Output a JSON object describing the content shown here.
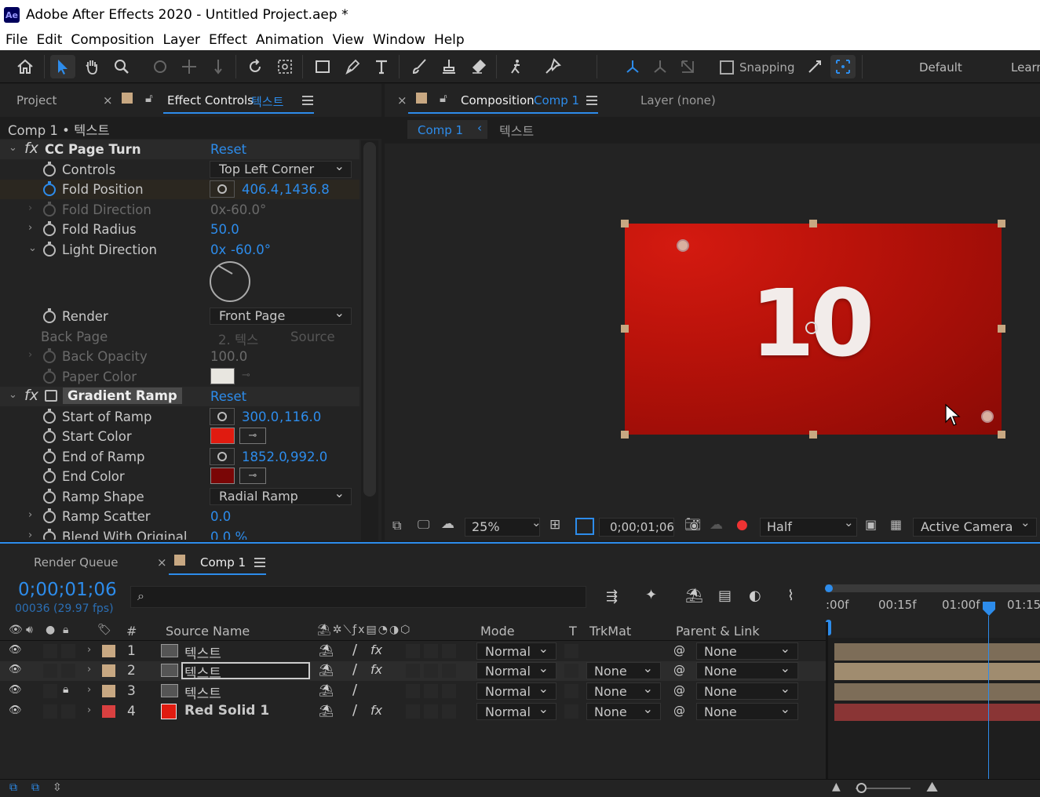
{
  "window": {
    "app_badge": "Ae",
    "title": "Adobe After Effects 2020 - Untitled Project.aep *"
  },
  "menu": [
    "File",
    "Edit",
    "Composition",
    "Layer",
    "Effect",
    "Animation",
    "View",
    "Window",
    "Help"
  ],
  "toolbar": {
    "snapping_label": "Snapping",
    "workspace": "Default",
    "learn": "Learn"
  },
  "left_panel": {
    "tab_project": "Project",
    "tab_effect_controls": "Effect Controls",
    "tab_effect_layer": "텍스트",
    "breadcrumb": "Comp 1 • 텍스트"
  },
  "effects": {
    "cc_page_turn": {
      "name": "CC Page Turn",
      "reset": "Reset",
      "controls_label": "Controls",
      "controls_value": "Top Left Corner",
      "fold_position_label": "Fold Position",
      "fold_position_x": "406.4",
      "fold_position_y": "1436.8",
      "fold_direction_label": "Fold Direction",
      "fold_direction_value": "0x-60.0°",
      "fold_radius_label": "Fold Radius",
      "fold_radius_value": "50.0",
      "light_direction_label": "Light Direction",
      "light_direction_rev": "0x",
      "light_direction_deg": "-60.0°",
      "render_label": "Render",
      "render_value": "Front Page",
      "back_page_label": "Back Page",
      "back_page_layer": "2. 텍스",
      "back_page_source": "Source",
      "back_opacity_label": "Back Opacity",
      "back_opacity_value": "100.0",
      "paper_color_label": "Paper Color"
    },
    "gradient_ramp": {
      "name": "Gradient Ramp",
      "reset": "Reset",
      "start_of_ramp_label": "Start of Ramp",
      "start_x": "300.0",
      "start_y": "116.0",
      "start_color_label": "Start Color",
      "end_of_ramp_label": "End of Ramp",
      "end_x": "1852.0",
      "end_y": "992.0",
      "end_color_label": "End Color",
      "ramp_shape_label": "Ramp Shape",
      "ramp_shape_value": "Radial Ramp",
      "ramp_scatter_label": "Ramp Scatter",
      "ramp_scatter_value": "0.0",
      "blend_label": "Blend With Original",
      "blend_value": "0.0 %"
    }
  },
  "colors": {
    "accent": "#2d8ceb",
    "start_color": "#e01b10",
    "end_color": "#7a0606",
    "paper_color": "#e8e6e0",
    "layer_label_tan": "#c8a882",
    "layer_label_red": "#d94040"
  },
  "comp_panel": {
    "tab_label": "Composition",
    "tab_comp": "Comp 1",
    "layer_tab": "Layer (none)",
    "nav_comp": "Comp 1",
    "nav_layer": "텍스트",
    "viewer_number": "10",
    "zoom": "25%",
    "timecode": "0;00;01;06",
    "resolution": "Half",
    "camera": "Active Camera"
  },
  "timeline": {
    "tab_render_queue": "Render Queue",
    "tab_comp": "Comp 1",
    "timecode": "0;00;01;06",
    "frame_info": "00036 (29.97 fps)",
    "search_placeholder": "",
    "col_num": "#",
    "col_source": "Source Name",
    "col_mode": "Mode",
    "col_t": "T",
    "col_trkmat": "TrkMat",
    "col_parent": "Parent & Link",
    "ruler": [
      ":00f",
      "00:15f",
      "01:00f",
      "01:15"
    ],
    "layers": [
      {
        "num": "1",
        "name": "텍스트",
        "mode": "Normal",
        "trkmat": "",
        "parent": "None"
      },
      {
        "num": "2",
        "name": "텍스트",
        "mode": "Normal",
        "trkmat": "None",
        "parent": "None"
      },
      {
        "num": "3",
        "name": "텍스트",
        "mode": "Normal",
        "trkmat": "None",
        "parent": "None"
      },
      {
        "num": "4",
        "name": "Red Solid 1",
        "mode": "Normal",
        "trkmat": "None",
        "parent": "None"
      }
    ]
  }
}
